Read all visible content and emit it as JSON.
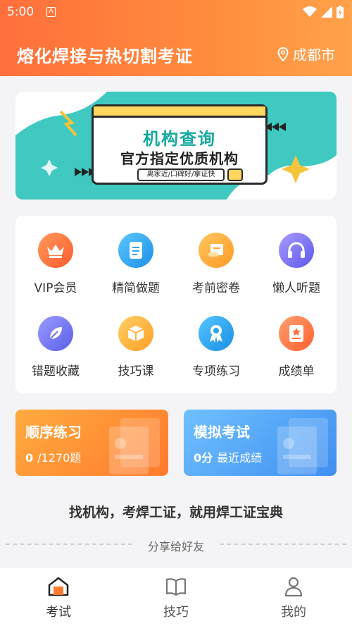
{
  "status_bar": {
    "time": "5:00",
    "notification_glyph": "A"
  },
  "header": {
    "title": "熔化焊接与热切割考证",
    "city": "成都市"
  },
  "banner": {
    "title": "机构查询",
    "subtitle": "官方指定优质机构",
    "tagline": "离家近/口碑好/拿证快"
  },
  "features": [
    {
      "label": "VIP会员",
      "icon": "crown-icon",
      "color": "#ff6a3a"
    },
    {
      "label": "精简做题",
      "icon": "document-icon",
      "color": "#2ea8f2"
    },
    {
      "label": "考前密卷",
      "icon": "scroll-icon",
      "color": "#ffa63b"
    },
    {
      "label": "懒人听题",
      "icon": "headphones-icon",
      "color": "#7a6ef5"
    },
    {
      "label": "错题收藏",
      "icon": "leaf-icon",
      "color": "#6e72f0"
    },
    {
      "label": "技巧课",
      "icon": "cube-icon",
      "color": "#ffb23c"
    },
    {
      "label": "专项练习",
      "icon": "award-icon",
      "color": "#23a7f0"
    },
    {
      "label": "成绩单",
      "icon": "report-icon",
      "color": "#ff6f3c"
    }
  ],
  "practice": {
    "sequential": {
      "title": "顺序练习",
      "count": "0",
      "total": "/1270题"
    },
    "mock": {
      "title": "模拟考试",
      "score": "0分",
      "caption": "最近成绩"
    }
  },
  "slogan": "找机构，考焊工证，就用焊工证宝典",
  "share_label": "分享给好友",
  "tabs": [
    {
      "label": "考试",
      "icon": "home-icon"
    },
    {
      "label": "技巧",
      "icon": "book-icon"
    },
    {
      "label": "我的",
      "icon": "user-icon"
    }
  ],
  "colors": {
    "header_start": "#ff6f3c",
    "header_end": "#ffa24a",
    "accent_blue": "#4ea6f5"
  }
}
